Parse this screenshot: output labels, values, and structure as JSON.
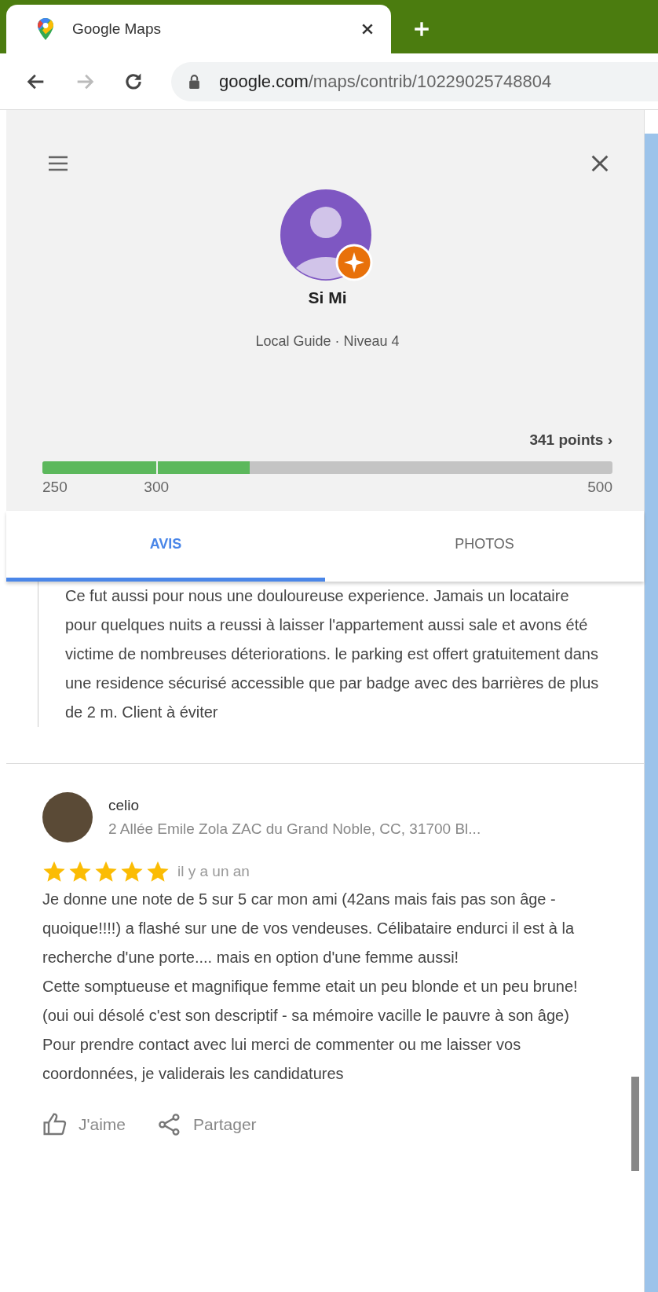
{
  "browser": {
    "tab_title": "Google Maps",
    "url_host": "google.com",
    "url_path": "/maps/contrib/10229025748804"
  },
  "profile": {
    "name": "Si Mi",
    "subtitle": "Local Guide · Niveau 4",
    "points": "341 points",
    "chevron": "›",
    "level": 0.364,
    "ticks": [
      "250",
      "300",
      "500"
    ]
  },
  "tabs": [
    {
      "label": "AVIS",
      "selected": true
    },
    {
      "label": "PHOTOS",
      "selected": false
    }
  ],
  "quoted_reply": "Ce fut aussi pour nous une douloureuse experience. Jamais un locataire pour quelques nuits a reussi à laisser l'appartement aussi sale et avons été victime de nombreuses déteriorations. le parking est offert gratuitement dans une residence sécurisé accessible que par badge avec des barrières de plus de 2 m. Client à éviter",
  "review": {
    "place": "celio",
    "address": "2 Allée Emile Zola ZAC du Grand Noble, CC, 31700 Bl...",
    "stars": 5,
    "time": "il y a un an",
    "paragraphs": [
      "Je donne une note de 5 sur 5 car mon ami (42ans mais fais pas son âge - quoique!!!!) a flashé sur une de vos vendeuses. Célibataire endurci il est à la recherche d'une porte.... mais en option d'une femme aussi!",
      "Cette somptueuse et magnifique femme etait un peu blonde et un peu brune! (oui oui désolé c'est son descriptif - sa mémoire vacille le pauvre à son âge)",
      "Pour prendre contact avec lui merci de commenter ou me laisser vos coordonnées, je validerais les candidatures"
    ],
    "actions": [
      "J'aime",
      "Partager"
    ]
  }
}
